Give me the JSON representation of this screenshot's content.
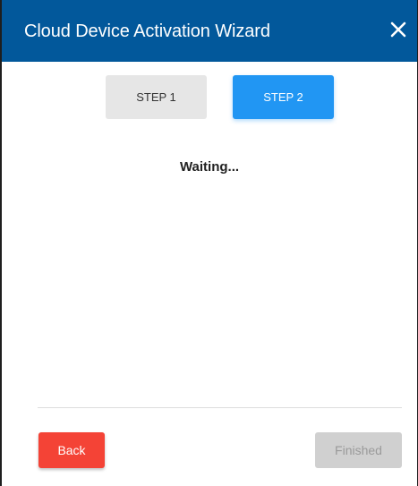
{
  "dialog": {
    "title": "Cloud Device Activation Wizard",
    "close_icon": "close-icon",
    "header_color": "#02589b"
  },
  "steps": [
    {
      "label": "STEP 1",
      "active": false
    },
    {
      "label": "STEP 2",
      "active": true
    }
  ],
  "status_text": "Waiting...",
  "footer": {
    "back_label": "Back",
    "finished_label": "Finished",
    "finished_enabled": false
  },
  "colors": {
    "accent": "#2196f3",
    "danger": "#f44336",
    "disabled": "#d0d0d0"
  }
}
